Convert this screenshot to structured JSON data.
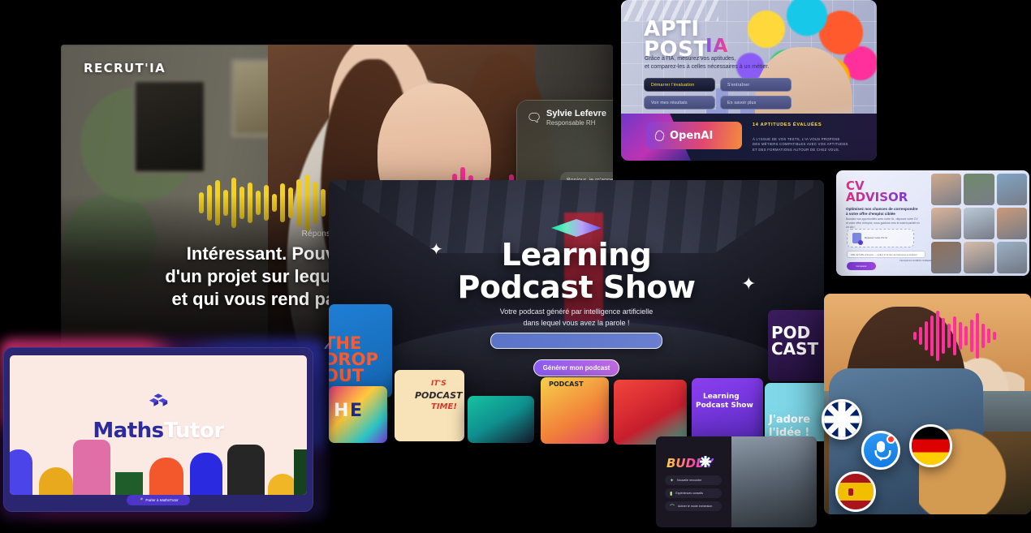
{
  "recrutia": {
    "logo": "RECRUT'IA",
    "response_label": "Réponse de Sylvie",
    "headline": "Intéressant. Pouvez-vous me parler\nd'un projet sur lequel vous avez travaillé\net qui vous rend particulièrement fier ?",
    "mic_icon": "microphone-icon",
    "chat": {
      "name": "Sylvie Lefevre",
      "role": "Responsable RH",
      "close_label": "✕",
      "message": "Bonjour, je m'appelle Thomas. J'ai un diplôme en informatique avec une spécialisation en développement web. J'ai travaillé pendant trois ans chez Webinnov en tant que développeur front-end, où j'ai acquis une solide expérience en HTML, CSS, JavaScript et en frameworks tels que React et..."
    }
  },
  "aptipost": {
    "title": "APTI\nPOST",
    "title_accent": "IA",
    "subtitle": "Grâce à l'IA, mesurez vos aptitudes,\net comparez-les à celles nécessaires à un métier.",
    "buttons": [
      {
        "label": "Démarrer l'évaluation",
        "primary": true
      },
      {
        "label": "S'entraîner",
        "primary": false
      },
      {
        "label": "Voir mes résultats",
        "primary": false
      },
      {
        "label": "En savoir plus",
        "primary": false
      }
    ],
    "badge": "OpenAI",
    "footer_title": "14 APTITUDES ÉVALUÉES",
    "footer_body": "À L'ISSUE DE VOS TESTS, L'IA VOUS PROPOSE\nDES MÉTIERS COMPATIBLES AVEC VOS APTITUDES\nET DES FORMATIONS AUTOUR DE CHEZ VOUS."
  },
  "cvadvisor": {
    "title": "CV\nADVISOR",
    "subtitle": "Optimisez nos chances de correspondre\nà votre offre d'emploi ciblée",
    "body": "Boostez vos opportunités avec notre IA : déposez votre CV\net votre offre d'emploi, nous guidons vers le match parfait en un clic !",
    "drop_title": "Déposez votre CV ici",
    "drop_hint": "Format PDF ou DOCX jusqu'à 5 MB",
    "field_value": "URL de l'offre d'emploi — Collez ici le lien de l'annonce à analyser",
    "checkbox_label": "J'accepte les conditions d'utilisation",
    "cta": "Comparer"
  },
  "podcast": {
    "title": "Learning\nPodcast Show",
    "subtitle": "Votre podcast généré par intelligence artificielle\ndans lequel vous avez la parole !",
    "input_value": "",
    "cta": "Générer mon podcast",
    "sparkle_icon": "sparkle-icon",
    "tiles": [
      {
        "name": "the-dropout",
        "lines": [
          "THE",
          "DROP",
          "OUT"
        ]
      },
      {
        "name": "heb",
        "lines": [
          "H",
          "E",
          "B"
        ]
      },
      {
        "name": "its-podcast-time",
        "lines": [
          "IT'S",
          "PODCAST",
          "TIME!"
        ]
      },
      {
        "name": "host-portrait",
        "lines": []
      },
      {
        "name": "podcast-yellow",
        "lines": [
          "PODCAST"
        ]
      },
      {
        "name": "red-portrait",
        "lines": []
      },
      {
        "name": "learning-podcast-show-tile",
        "lines": [
          "Learning",
          "Podcast Show"
        ]
      },
      {
        "name": "pod-cast-dark",
        "lines": [
          "POD",
          "CAST"
        ]
      },
      {
        "name": "jadore-lidee",
        "lines": [
          "J'adore",
          "l'idée !"
        ]
      }
    ]
  },
  "maths": {
    "title_a": "Maths",
    "title_b": "Tutor",
    "logo_icon": "cube-logo-icon",
    "button": "Parler à MathsTutor",
    "button_icon": "microphone-icon"
  },
  "buddy": {
    "logo": "BUDDY",
    "flag": "uk-flag-icon",
    "items": [
      {
        "label": "Nouvelle rencontre",
        "icon": "sparkle-icon"
      },
      {
        "label": "Expériences conseils",
        "icon": "bag-icon"
      },
      {
        "label": "Activer le mode immersion",
        "icon": "headphones-icon"
      }
    ]
  },
  "languages": {
    "mic_icon": "microphone-icon",
    "flags": [
      {
        "name": "uk-flag",
        "label": "Royaume-Uni"
      },
      {
        "name": "de-flag",
        "label": "Allemagne"
      },
      {
        "name": "es-flag",
        "label": "Espagne"
      }
    ]
  }
}
